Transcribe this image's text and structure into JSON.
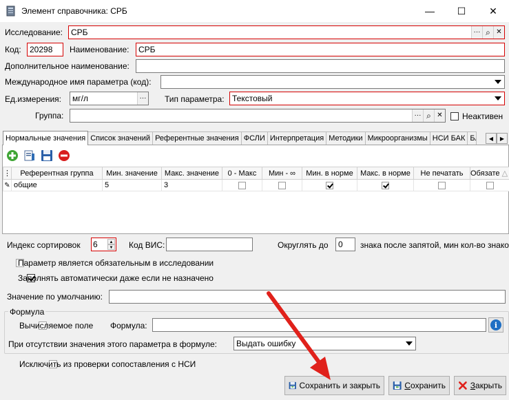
{
  "window": {
    "title": "Элемент справочника: СРБ",
    "minimize": "—",
    "maximize": "☐",
    "close": "✕"
  },
  "fields": {
    "research_label": "Исследование:",
    "research_value": "СРБ",
    "code_label": "Код:",
    "code_value": "20298",
    "name_label": "Наименование:",
    "name_value": "СРБ",
    "additional_name_label": "Дополнительное наименование:",
    "additional_name_value": "",
    "intl_name_label": "Международное имя параметра (код):",
    "intl_name_value": "",
    "unit_label": "Ед.измерения:",
    "unit_value": "мг/л",
    "param_type_label": "Тип параметра:",
    "param_type_value": "Текстовый",
    "group_label": "Группа:",
    "group_value": "",
    "inactive_label": "Неактивен",
    "ellipsis": "···",
    "search_glyph": "⌕",
    "clear_glyph": "✕"
  },
  "tabs": [
    {
      "label": "Нормальные значения",
      "active": true
    },
    {
      "label": "Список значений",
      "active": false
    },
    {
      "label": "Референтные значения",
      "active": false
    },
    {
      "label": "ФСЛИ",
      "active": false
    },
    {
      "label": "Интерпретация",
      "active": false
    },
    {
      "label": "Методики",
      "active": false
    },
    {
      "label": "Микроорганизмы",
      "active": false
    },
    {
      "label": "НСИ БАК",
      "active": false
    },
    {
      "label": "Бл",
      "active": false
    }
  ],
  "tab_scroll": {
    "left": "◀",
    "right": "▶"
  },
  "grid": {
    "columns": [
      "Референтная группа",
      "Мин. значение",
      "Макс. значение",
      "0 - Макс",
      "Мин - ∞",
      "Мин. в норме",
      "Макс. в норме",
      "Не печатать",
      "Обязате"
    ],
    "sort_glyph": "△",
    "rows": [
      {
        "group": "общие",
        "min": "5",
        "max": "3",
        "zero_max": false,
        "min_inf": false,
        "min_norm": true,
        "max_norm": true,
        "no_print": false,
        "required": false
      }
    ]
  },
  "sort": {
    "index_label": "Индекс сортировок",
    "index_value": "6",
    "vis_label": "Код ВИС:",
    "vis_value": "",
    "round_label": "Округлять до",
    "round_value": "0",
    "round_suffix": "знака после запятой, мин кол-во знаков"
  },
  "options": {
    "required_label": "Параметр является обязательным в исследовании",
    "required_checked": false,
    "autofill_label": "Заполнять автоматически даже если не назначено",
    "autofill_checked": true,
    "default_label": "Значение по умолчанию:",
    "default_value": ""
  },
  "formula": {
    "group_title": "Формула",
    "calc_label": "Вычисляемое поле",
    "calc_checked": false,
    "formula_label": "Формула:",
    "formula_value": "",
    "missing_label": "При отсутствии значения этого параметра в формуле:",
    "missing_value": "Выдать ошибку",
    "info_glyph": "i"
  },
  "exclude": {
    "label": "Исключить из проверки сопоставления с НСИ",
    "checked": false
  },
  "buttons": {
    "save_close": "Сохранить и закрыть",
    "save_prefix": "",
    "save_hot": "С",
    "save_rest": "охранить",
    "close_hot": "З",
    "close_rest": "акрыть"
  },
  "colors": {
    "required_border": "#d40000",
    "accent_red": "#e0211b",
    "info_blue": "#1f6fc4"
  }
}
